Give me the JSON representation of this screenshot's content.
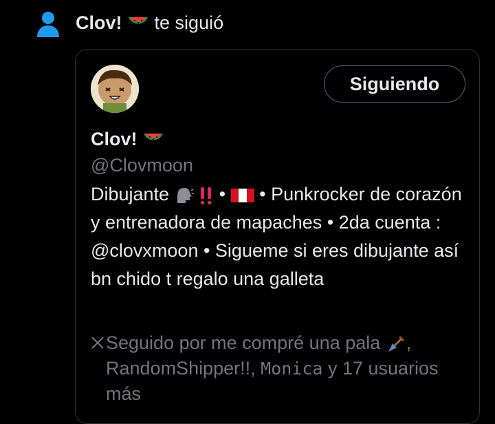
{
  "notification": {
    "name": "Clov!",
    "action": "te siguió",
    "icon": "person-icon",
    "accent": "#1d9bf0"
  },
  "profile": {
    "display_name": "Clov!",
    "handle": "@Clovmoon",
    "follow_button": "Siguiendo",
    "bio_part1": "Dibujante",
    "bio_part2": "•",
    "bio_part3": "• Punkrocker de corazón y entrenadora de mapaches • 2da cuenta : @clovxmoon • Sigueme si eres dibujante así bn chido t regalo una galleta",
    "followed_by_prefix": "Seguido por me compré una pala",
    "followed_by_mid": ", RandomShipper!!,",
    "followed_by_name3": "Monica",
    "followed_by_suffix": "y 17 usuarios más"
  }
}
